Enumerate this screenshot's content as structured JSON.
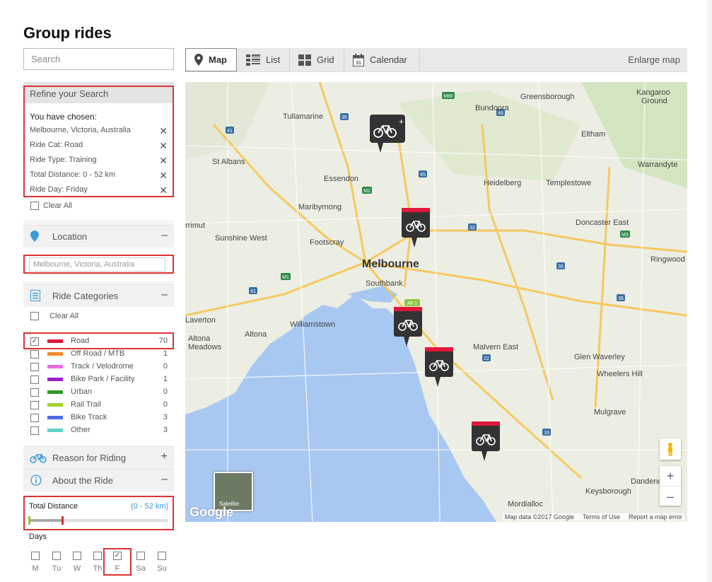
{
  "page": {
    "title": "Group rides"
  },
  "search": {
    "placeholder": "Search"
  },
  "toolbar": {
    "tabs": [
      {
        "label": "Map",
        "icon": "map-pin-icon"
      },
      {
        "label": "List",
        "icon": "list-icon"
      },
      {
        "label": "Grid",
        "icon": "grid-icon"
      },
      {
        "label": "Calendar",
        "icon": "calendar-icon"
      }
    ],
    "active_tab": "Map",
    "enlarge_label": "Enlarge map"
  },
  "refine": {
    "heading": "Refine your Search",
    "chosen_label": "You have chosen:",
    "chosen": [
      "Melbourne, Victoria, Australia",
      "Ride Cat: Road",
      "Ride Type: Training",
      "Total Distance: 0 - 52 km",
      "Ride Day: Friday"
    ],
    "clear_all": "Clear All"
  },
  "location": {
    "heading": "Location",
    "toggle": "–",
    "value": "Melbourne, Victoria, Australia"
  },
  "categories": {
    "heading": "Ride Categories",
    "toggle": "–",
    "clear_all": "Clear All",
    "items": [
      {
        "name": "Road",
        "count": "70",
        "color": "#e0173a",
        "checked": true
      },
      {
        "name": "Off Road / MTB",
        "count": "1",
        "color": "#f08a2c",
        "checked": false
      },
      {
        "name": "Track / Velodrome",
        "count": "0",
        "color": "#e86ce0",
        "checked": false
      },
      {
        "name": "Bike Park / Facility",
        "count": "1",
        "color": "#9b1fc9",
        "checked": false
      },
      {
        "name": "Urban",
        "count": "0",
        "color": "#2f9a2a",
        "checked": false
      },
      {
        "name": "Rail Trail",
        "count": "0",
        "color": "#a6cf2c",
        "checked": false
      },
      {
        "name": "Bike Track",
        "count": "3",
        "color": "#4d6ee8",
        "checked": false
      },
      {
        "name": "Other",
        "count": "3",
        "color": "#5fd3c8",
        "checked": false
      }
    ]
  },
  "reason": {
    "heading": "Reason for Riding",
    "toggle": "+"
  },
  "about": {
    "heading": "About the Ride",
    "toggle": "–"
  },
  "distance": {
    "label": "Total Distance",
    "value": "(0 - 52 km)",
    "fill_fraction": 0.24
  },
  "days": {
    "label": "Days",
    "items": [
      {
        "label": "M",
        "checked": false
      },
      {
        "label": "Tu",
        "checked": false
      },
      {
        "label": "W",
        "checked": false
      },
      {
        "label": "Th",
        "checked": false
      },
      {
        "label": "F",
        "checked": true
      },
      {
        "label": "Sa",
        "checked": false
      },
      {
        "label": "Su",
        "checked": false
      }
    ]
  },
  "map": {
    "places": [
      "Tullamarine",
      "Bundoora",
      "Greensborough",
      "Kangaroo Ground",
      "Eltham",
      "St Albans",
      "Essendon",
      "Heidelberg",
      "Templestowe",
      "Warrandyte",
      "Maribyrnong",
      "Doncaster East",
      "Sunshine West",
      "Footscray",
      "Melbourne",
      "Ringwood",
      "Southbank",
      "Williamstown",
      "Altona",
      "Altona Meadows",
      "Malvern East",
      "Glen Waverley",
      "Wheelers Hill",
      "Mulgrave",
      "Keysborough",
      "Mordialloc",
      "Dandenong",
      "Laverton",
      "rrimut"
    ],
    "satellite_label": "Satellite",
    "google_label": "Google",
    "footer": [
      "Map data ©2017 Google",
      "Terms of Use",
      "Report a map error"
    ],
    "zoom_in": "+",
    "zoom_out": "–",
    "accent": "#e0173a"
  }
}
